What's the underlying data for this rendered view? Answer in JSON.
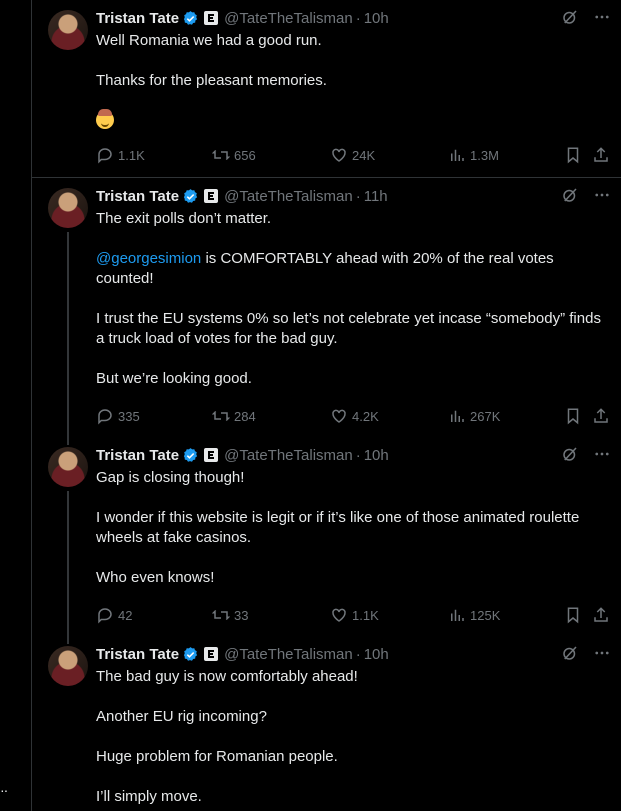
{
  "rail": {
    "more_label": "··"
  },
  "tweets": [
    {
      "author": "Tristan Tate",
      "handle": "@TateTheTalisman",
      "time": "10h",
      "paragraphs": [
        "Well Romania we had a good run.",
        "Thanks for the pleasant memories."
      ],
      "emoji": "cowboy-face-emoji",
      "stats": {
        "replies": "1.1K",
        "reposts": "656",
        "likes": "24K",
        "views": "1.3M"
      }
    },
    {
      "author": "Tristan Tate",
      "handle": "@TateTheTalisman",
      "time": "11h",
      "paragraphs": [
        "The exit polls don’t matter.",
        "is COMFORTABLY ahead with 20% of the real votes counted!",
        "I trust the EU systems 0% so let’s not celebrate yet incase “somebody” finds a truck load of votes for the bad guy.",
        "But we’re looking good."
      ],
      "mention": "@georgesimion",
      "stats": {
        "replies": "335",
        "reposts": "284",
        "likes": "4.2K",
        "views": "267K"
      }
    },
    {
      "author": "Tristan Tate",
      "handle": "@TateTheTalisman",
      "time": "10h",
      "paragraphs": [
        "Gap is closing though!",
        "I wonder if this website is legit or if it’s like one of those animated roulette wheels at fake casinos.",
        "Who even knows!"
      ],
      "stats": {
        "replies": "42",
        "reposts": "33",
        "likes": "1.1K",
        "views": "125K"
      }
    },
    {
      "author": "Tristan Tate",
      "handle": "@TateTheTalisman",
      "time": "10h",
      "paragraphs": [
        "The bad guy is now comfortably ahead!",
        "Another EU rig incoming?",
        "Huge problem for Romanian people.",
        "I’ll simply move."
      ]
    }
  ],
  "icons": {
    "verified": "verified-badge-icon",
    "affiliate": "affiliate-badge-icon",
    "grok": "grok-icon",
    "more": "more-icon",
    "reply": "reply-icon",
    "repost": "repost-icon",
    "like": "like-icon",
    "views": "views-icon",
    "bookmark": "bookmark-icon",
    "share": "share-icon"
  },
  "colors": {
    "background": "#000000",
    "text": "#e7e9ea",
    "secondary": "#71767b",
    "accent": "#1d9bf0",
    "border": "#2f3336"
  }
}
